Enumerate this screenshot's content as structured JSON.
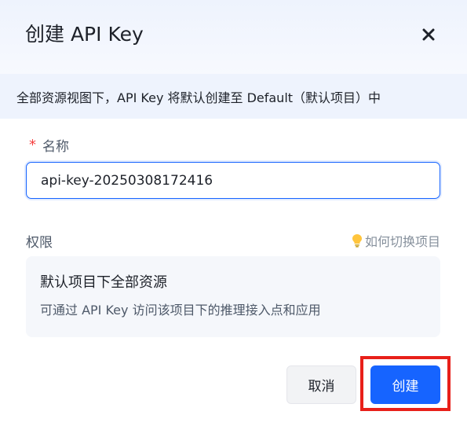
{
  "dialog": {
    "title": "创建 API Key",
    "close_icon": "close-icon",
    "notice": "全部资源视图下，API Key 将默认创建至 Default（默认项目）中"
  },
  "name_field": {
    "required_mark": "*",
    "label": "名称",
    "value": "api-key-20250308172416"
  },
  "permission": {
    "label": "权限",
    "help_icon": "lightbulb-icon",
    "help_link": "如何切换项目",
    "card_title": "默认项目下全部资源",
    "card_desc": "可通过 API Key 访问该项目下的推理接入点和应用"
  },
  "footer": {
    "cancel_label": "取消",
    "create_label": "创建",
    "highlight_color": "#e8201a"
  },
  "colors": {
    "primary": "#1664ff",
    "required": "#f53f3f"
  }
}
